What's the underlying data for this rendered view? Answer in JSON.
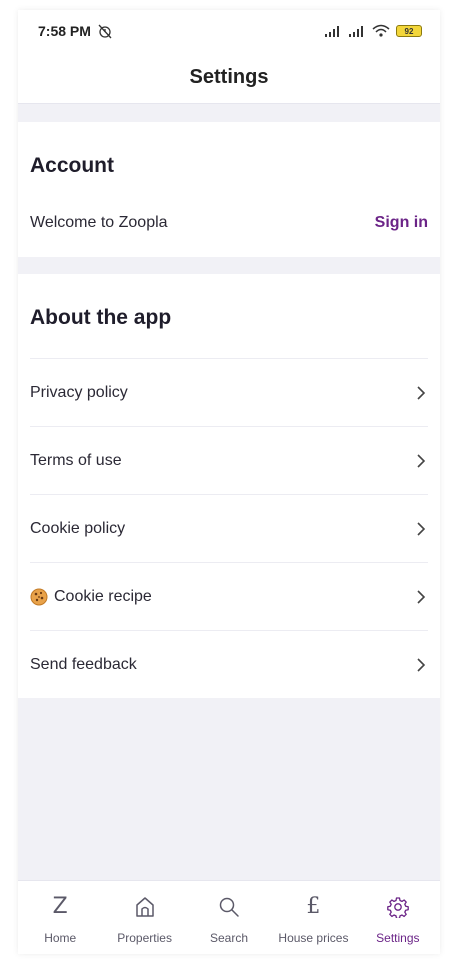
{
  "status_bar": {
    "time": "7:58 PM",
    "battery": "92"
  },
  "header": {
    "title": "Settings"
  },
  "account": {
    "title": "Account",
    "welcome": "Welcome to Zoopla",
    "sign_in": "Sign in"
  },
  "about": {
    "title": "About the app",
    "items": [
      {
        "label": "Privacy policy",
        "icon": "chevron-right-icon"
      },
      {
        "label": "Terms of use",
        "icon": "chevron-right-icon"
      },
      {
        "label": "Cookie policy",
        "icon": "chevron-right-icon"
      },
      {
        "label": "Cookie recipe",
        "icon": "chevron-right-icon",
        "emoji": "cookie-icon"
      },
      {
        "label": "Send feedback",
        "icon": "chevron-right-icon"
      }
    ]
  },
  "bottom_nav": {
    "items": [
      {
        "label": "Home",
        "icon": "zoopla-z-icon"
      },
      {
        "label": "Properties",
        "icon": "house-icon"
      },
      {
        "label": "Search",
        "icon": "search-icon"
      },
      {
        "label": "House prices",
        "icon": "pound-icon"
      },
      {
        "label": "Settings",
        "icon": "gear-icon",
        "active": true
      }
    ]
  },
  "colors": {
    "brand": "#6b2487",
    "background": "#f1f1f6",
    "text": "#1f1d2b"
  }
}
